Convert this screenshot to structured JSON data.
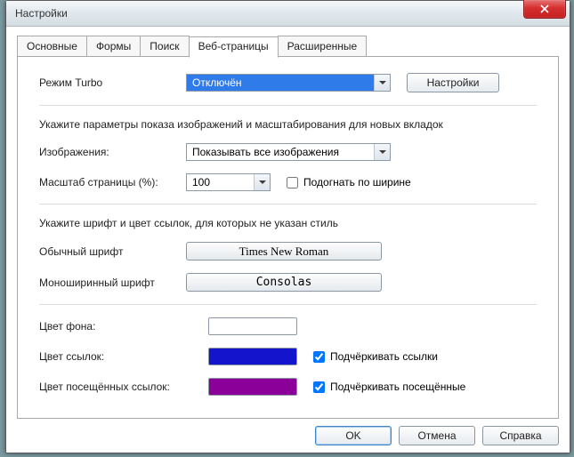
{
  "window": {
    "title": "Настройки"
  },
  "tabs": [
    "Основные",
    "Формы",
    "Поиск",
    "Веб-страницы",
    "Расширенные"
  ],
  "active_tab": 3,
  "turbo": {
    "label": "Режим Turbo",
    "value": "Отключён",
    "settings_button": "Настройки"
  },
  "images_section": {
    "hint": "Укажите параметры показа изображений и масштабирования для новых вкладок",
    "images_label": "Изображения:",
    "images_value": "Показывать все изображения",
    "zoom_label": "Масштаб страницы (%):",
    "zoom_value": "100",
    "fit_width_label": "Подогнать по ширине",
    "fit_width_checked": false
  },
  "fonts_section": {
    "hint": "Укажите шрифт и цвет ссылок, для которых не указан стиль",
    "normal_font_label": "Обычный шрифт",
    "normal_font_value": "Times New Roman",
    "mono_font_label": "Моноширинный шрифт",
    "mono_font_value": "Consolas"
  },
  "colors_section": {
    "bg_label": "Цвет фона:",
    "bg_color": "#ffffff",
    "link_label": "Цвет ссылок:",
    "link_color": "#1414cc",
    "underline_links_label": "Подчёркивать ссылки",
    "underline_links_checked": true,
    "visited_label": "Цвет посещённых ссылок:",
    "visited_color": "#8a0099",
    "underline_visited_label": "Подчёркивать посещённые",
    "underline_visited_checked": true
  },
  "buttons": {
    "ok": "OK",
    "cancel": "Отмена",
    "help": "Справка"
  }
}
